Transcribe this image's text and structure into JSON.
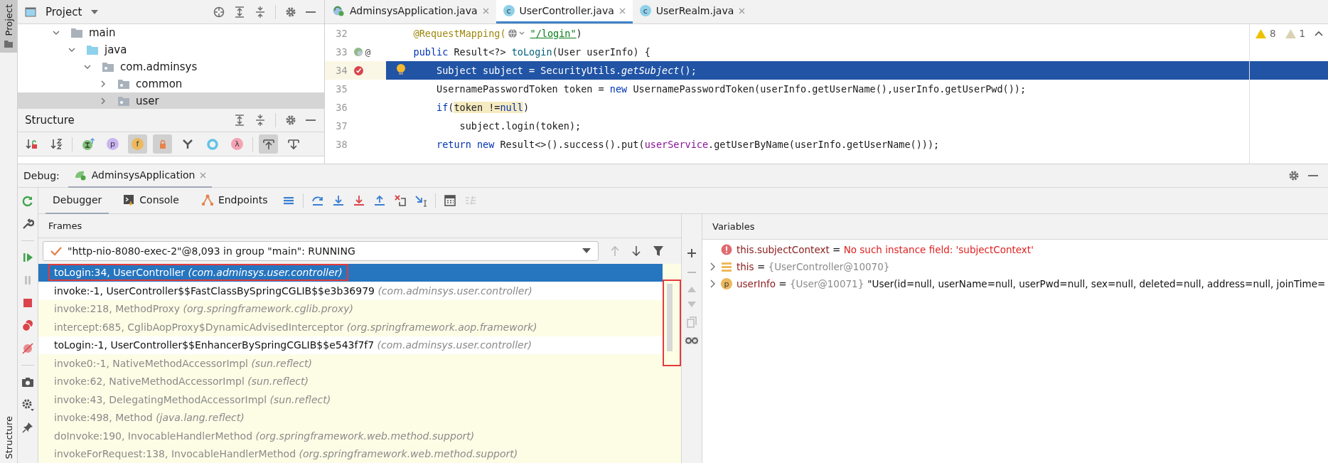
{
  "side_strip": {
    "tabs": [
      {
        "label": "Project",
        "selected": true
      },
      {
        "label": "Structure",
        "selected": false
      }
    ]
  },
  "project_panel": {
    "title": "Project",
    "tree": [
      {
        "label": "main",
        "kind": "folder",
        "expanded": true,
        "selected": false,
        "children": [
          {
            "label": "java",
            "kind": "source-folder",
            "expanded": true,
            "selected": false,
            "children": [
              {
                "label": "com.adminsys",
                "kind": "package",
                "expanded": true,
                "selected": false,
                "children": [
                  {
                    "label": "common",
                    "kind": "package",
                    "expanded": false,
                    "selected": false
                  },
                  {
                    "label": "user",
                    "kind": "package",
                    "expanded": false,
                    "selected": true
                  }
                ]
              }
            ]
          }
        ]
      }
    ]
  },
  "structure_panel": {
    "title": "Structure",
    "tools": [
      {
        "kind": "sort-visibility",
        "on": false
      },
      {
        "kind": "sort-alpha",
        "on": false
      },
      {
        "kind": "sep"
      },
      {
        "kind": "inherited",
        "on": false
      },
      {
        "kind": "glyph",
        "glyph": "p",
        "color": "#c9b6f0",
        "on": false
      },
      {
        "kind": "glyph",
        "glyph": "f",
        "color": "#edb95e",
        "on": true
      },
      {
        "kind": "lock",
        "on": true
      },
      {
        "kind": "fork",
        "on": false
      },
      {
        "kind": "ring",
        "on": false
      },
      {
        "kind": "glyph",
        "glyph": "λ",
        "color": "#f4a3b4",
        "on": false
      },
      {
        "kind": "sep"
      },
      {
        "kind": "scroll-from",
        "on": true
      },
      {
        "kind": "scroll-to",
        "on": false
      }
    ]
  },
  "editor": {
    "tabs": [
      {
        "label": "AdminsysApplication.java",
        "kind": "app",
        "selected": false
      },
      {
        "label": "UserController.java",
        "kind": "class",
        "glyph": "c",
        "selected": true
      },
      {
        "label": "UserRealm.java",
        "kind": "class",
        "glyph": "c",
        "selected": false
      }
    ],
    "warnings": "8",
    "weak_warnings": "1",
    "lines": [
      {
        "number": "32",
        "current": false,
        "tokens": [
          {
            "kind": "annotation",
            "text": "    @RequestMapping("
          },
          {
            "kind": "web-icon"
          },
          {
            "kind": "url",
            "text": "\"/login\""
          },
          {
            "kind": "plain",
            "text": ")"
          }
        ]
      },
      {
        "number": "33",
        "current": false,
        "gutter": [
          {
            "kind": "bean"
          },
          {
            "kind": "glyph",
            "text": "@"
          }
        ],
        "tokens": [
          {
            "kind": "keyword",
            "text": "    public "
          },
          {
            "kind": "plain",
            "text": "Result<?> "
          },
          {
            "kind": "decl",
            "text": "toLogin"
          },
          {
            "kind": "plain",
            "text": "(User userInfo) {"
          }
        ]
      },
      {
        "number": "34",
        "current": true,
        "gutter": [
          {
            "kind": "breakpoint"
          }
        ],
        "tokens": [
          {
            "kind": "plain",
            "text": "        Subject subject = SecurityUtils."
          },
          {
            "kind": "italic",
            "text": "getSubject"
          },
          {
            "kind": "plain",
            "text": "();"
          }
        ]
      },
      {
        "number": "35",
        "current": false,
        "tokens": [
          {
            "kind": "plain",
            "text": "        UsernamePasswordToken token = "
          },
          {
            "kind": "keyword",
            "text": "new "
          },
          {
            "kind": "plain",
            "text": "UsernamePasswordToken(userInfo.getUserName(),userInfo.getUserPwd());"
          }
        ]
      },
      {
        "number": "36",
        "current": false,
        "tokens": [
          {
            "kind": "keyword",
            "text": "        if"
          },
          {
            "kind": "plain",
            "text": "("
          },
          {
            "kind": "usage",
            "text": "token !="
          },
          {
            "kind": "usage-keyword",
            "text": "null"
          },
          {
            "kind": "plain",
            "text": ")"
          }
        ]
      },
      {
        "number": "37",
        "current": false,
        "tokens": [
          {
            "kind": "plain",
            "text": "            subject.login(token);"
          }
        ]
      },
      {
        "number": "38",
        "current": false,
        "tokens": [
          {
            "kind": "keyword",
            "text": "        return new "
          },
          {
            "kind": "plain",
            "text": "Result<>().success().put("
          },
          {
            "kind": "field",
            "text": "userService"
          },
          {
            "kind": "plain",
            "text": ".getUserByName(userInfo.getUserName()));"
          }
        ]
      }
    ]
  },
  "debug": {
    "label": "Debug:",
    "session": "AdminsysApplication",
    "side_tools": [
      {
        "kind": "rerun",
        "disabled": false
      },
      {
        "kind": "wrench",
        "disabled": false
      },
      {
        "kind": "sep"
      },
      {
        "kind": "resume",
        "disabled": false
      },
      {
        "kind": "pause",
        "disabled": true
      },
      {
        "kind": "stop",
        "disabled": false
      },
      {
        "kind": "breakpoints",
        "disabled": false
      },
      {
        "kind": "mute",
        "disabled": false
      },
      {
        "kind": "sep"
      },
      {
        "kind": "camera",
        "disabled": false
      },
      {
        "kind": "gear",
        "disabled": false
      },
      {
        "kind": "pin",
        "disabled": false
      }
    ],
    "tabs": [
      {
        "label": "Debugger",
        "kind": "plain",
        "selected": true
      },
      {
        "label": "Console",
        "kind": "console",
        "selected": false
      },
      {
        "label": "Endpoints",
        "kind": "endpoints",
        "selected": false
      }
    ],
    "step_tools": [
      {
        "kind": "menu",
        "disabled": false
      },
      {
        "kind": "sep"
      },
      {
        "kind": "step-over",
        "disabled": false
      },
      {
        "kind": "step-into",
        "disabled": false
      },
      {
        "kind": "force-step-into",
        "disabled": false
      },
      {
        "kind": "step-out",
        "disabled": false
      },
      {
        "kind": "drop-frame",
        "disabled": false
      },
      {
        "kind": "run-to-cursor",
        "disabled": false
      },
      {
        "kind": "sep"
      },
      {
        "kind": "evaluate",
        "disabled": false
      },
      {
        "kind": "trace",
        "disabled": true
      }
    ],
    "frames": {
      "title": "Frames",
      "thread": "\"http-nio-8080-exec-2\"@8,093 in group \"main\": RUNNING",
      "scroll_highlighted": true,
      "items": [
        {
          "method": "toLogin:34, UserController",
          "package": "(com.adminsys.user.controller)",
          "kind": "project",
          "selected": true,
          "highlighted": true
        },
        {
          "method": "invoke:-1, UserController$$FastClassBySpringCGLIB$$e3b36979",
          "package": "(com.adminsys.user.controller)",
          "kind": "project",
          "selected": false,
          "highlighted": false
        },
        {
          "method": "invoke:218, MethodProxy",
          "package": "(org.springframework.cglib.proxy)",
          "kind": "library",
          "selected": false,
          "highlighted": false
        },
        {
          "method": "intercept:685, CglibAopProxy$DynamicAdvisedInterceptor",
          "package": "(org.springframework.aop.framework)",
          "kind": "library",
          "selected": false,
          "highlighted": false
        },
        {
          "method": "toLogin:-1, UserController$$EnhancerBySpringCGLIB$$e543f7f7",
          "package": "(com.adminsys.user.controller)",
          "kind": "project",
          "selected": false,
          "highlighted": false
        },
        {
          "method": "invoke0:-1, NativeMethodAccessorImpl",
          "package": "(sun.reflect)",
          "kind": "library",
          "selected": false,
          "highlighted": false
        },
        {
          "method": "invoke:62, NativeMethodAccessorImpl",
          "package": "(sun.reflect)",
          "kind": "library",
          "selected": false,
          "highlighted": false
        },
        {
          "method": "invoke:43, DelegatingMethodAccessorImpl",
          "package": "(sun.reflect)",
          "kind": "library",
          "selected": false,
          "highlighted": false
        },
        {
          "method": "invoke:498, Method",
          "package": "(java.lang.reflect)",
          "kind": "library",
          "selected": false,
          "highlighted": false
        },
        {
          "method": "doInvoke:190, InvocableHandlerMethod",
          "package": "(org.springframework.web.method.support)",
          "kind": "library",
          "selected": false,
          "highlighted": false
        },
        {
          "method": "invokeForRequest:138, InvocableHandlerMethod",
          "package": "(org.springframework.web.method.support)",
          "kind": "library",
          "selected": false,
          "highlighted": false
        }
      ]
    },
    "variables": {
      "title": "Variables",
      "items": [
        {
          "kind": "error",
          "expandable": false,
          "name": "this.subjectContext",
          "equals": "=",
          "value": "No such instance field: 'subjectContext'"
        },
        {
          "kind": "field",
          "expandable": true,
          "name": "this",
          "equals": "=",
          "value": "{UserController@10070}"
        },
        {
          "kind": "param",
          "expandable": true,
          "glyph": "p",
          "name": "userInfo",
          "equals": "=",
          "value": "{User@10071}",
          "detail": "\"User(id=null, userName=null, userPwd=null, sex=null, deleted=null, address=null, joinTime="
        }
      ]
    }
  }
}
